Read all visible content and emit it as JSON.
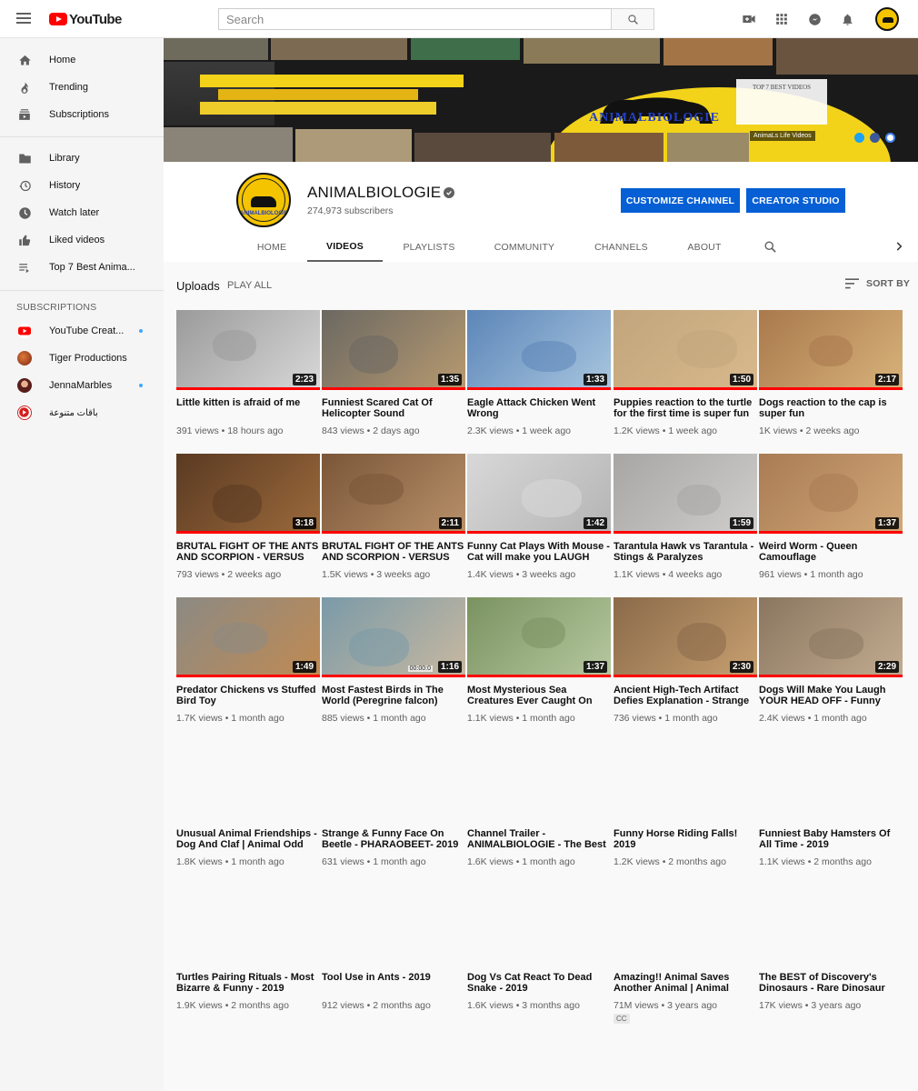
{
  "topbar": {
    "logo_text": "YouTube",
    "search_placeholder": "Search",
    "search_value": ""
  },
  "sidebar": {
    "main": [
      {
        "label": "Home",
        "icon": "home-icon"
      },
      {
        "label": "Trending",
        "icon": "flame-icon"
      },
      {
        "label": "Subscriptions",
        "icon": "subscriptions-icon"
      }
    ],
    "library": [
      {
        "label": "Library",
        "icon": "folder-icon"
      },
      {
        "label": "History",
        "icon": "history-icon"
      },
      {
        "label": "Watch later",
        "icon": "clock-icon"
      },
      {
        "label": "Liked videos",
        "icon": "thumbs-up-icon"
      },
      {
        "label": "Top 7 Best Anima...",
        "icon": "playlist-icon"
      }
    ],
    "subscriptions_heading": "SUBSCRIPTIONS",
    "subscriptions": [
      {
        "label": "YouTube Creat...",
        "color": "#ff0000",
        "new": true
      },
      {
        "label": "Tiger Productions",
        "color": "#b5421a",
        "new": false
      },
      {
        "label": "JennaMarbles",
        "color": "#7a2a2a",
        "new": true
      },
      {
        "label": "باقات متنوعة",
        "color": "#d32020",
        "new": false
      }
    ]
  },
  "banner": {
    "center_name": "ANIMALBIOLOGIE",
    "side_text": "TOP 7 BEST VIDEOS",
    "tag": "AnimaLs Life Videos"
  },
  "channel": {
    "avatar_label": "ANIMALBIOLOGIE",
    "name": "ANIMALBIOLOGIE",
    "subscribers": "274,973 subscribers",
    "customize_label": "CUSTOMIZE CHANNEL",
    "studio_label": "CREATOR STUDIO",
    "tabs": [
      "HOME",
      "VIDEOS",
      "PLAYLISTS",
      "COMMUNITY",
      "CHANNELS",
      "ABOUT"
    ],
    "active_tab": "VIDEOS"
  },
  "section": {
    "title": "Uploads",
    "play_all": "PLAY ALL",
    "sort_by": "SORT BY"
  },
  "videos": [
    {
      "title": "Little kitten is afraid of me",
      "views": "391 views",
      "age": "18 hours ago",
      "duration": "2:23",
      "colors": [
        "#9a9a9a",
        "#d8d8d8"
      ]
    },
    {
      "title": "Funniest Scared Cat Of Helicopter Sound",
      "views": "843 views",
      "age": "2 days ago",
      "duration": "1:35",
      "colors": [
        "#6b6862",
        "#b79a70"
      ]
    },
    {
      "title": "Eagle Attack Chicken Went Wrong",
      "views": "2.3K views",
      "age": "1 week ago",
      "duration": "1:33",
      "colors": [
        "#5c86b8",
        "#a9c6e0"
      ]
    },
    {
      "title": "Puppies reaction to the turtle for the first time is super fun",
      "views": "1.2K views",
      "age": "1 week ago",
      "duration": "1:50",
      "colors": [
        "#c2a57c",
        "#d8b98c"
      ]
    },
    {
      "title": "Dogs reaction to the cap is super fun",
      "views": "1K views",
      "age": "2 weeks ago",
      "duration": "2:17",
      "colors": [
        "#a9794c",
        "#d8b27a"
      ]
    },
    {
      "title": "BRUTAL FIGHT OF THE ANTS AND SCORPION - VERSUS OF",
      "views": "793 views",
      "age": "2 weeks ago",
      "duration": "3:18",
      "colors": [
        "#5a3a22",
        "#9c6a3c"
      ]
    },
    {
      "title": "BRUTAL FIGHT OF THE ANTS AND SCORPION - VERSUS OF",
      "views": "1.5K views",
      "age": "3 weeks ago",
      "duration": "2:11",
      "colors": [
        "#7a5638",
        "#b8906a"
      ]
    },
    {
      "title": "Funny Cat Plays With Mouse - Cat will make you LAUGH",
      "views": "1.4K views",
      "age": "3 weeks ago",
      "duration": "1:42",
      "colors": [
        "#d8d8d8",
        "#b4b4b4"
      ]
    },
    {
      "title": "Tarantula Hawk vs Tarantula - Stings & Paralyzes",
      "views": "1.1K views",
      "age": "4 weeks ago",
      "duration": "1:59",
      "colors": [
        "#a8a6a4",
        "#d0cecc"
      ]
    },
    {
      "title": "Weird Worm - Queen Camouflage",
      "views": "961 views",
      "age": "1 month ago",
      "duration": "1:37",
      "colors": [
        "#a97c54",
        "#d2a878"
      ]
    },
    {
      "title": "Predator Chickens vs Stuffed Bird Toy",
      "views": "1.7K views",
      "age": "1 month ago",
      "duration": "1:49",
      "colors": [
        "#8c8a84",
        "#c08a52"
      ]
    },
    {
      "title": "Most Fastest Birds in The World (Peregrine falcon)",
      "views": "885 views",
      "age": "1 month ago",
      "duration": "1:16",
      "colors": [
        "#7a9aa8",
        "#c8b8a0"
      ],
      "overlay": "00:00:0"
    },
    {
      "title": "Most Mysterious Sea Creatures Ever Caught On",
      "views": "1.1K views",
      "age": "1 month ago",
      "duration": "1:37",
      "colors": [
        "#7a9260",
        "#b6c8a0"
      ]
    },
    {
      "title": "Ancient High-Tech Artifact Defies Explanation - Strange",
      "views": "736 views",
      "age": "1 month ago",
      "duration": "2:30",
      "colors": [
        "#8a6a4a",
        "#c8a070"
      ]
    },
    {
      "title": "Dogs Will Make You Laugh YOUR HEAD OFF - Funny",
      "views": "2.4K views",
      "age": "1 month ago",
      "duration": "2:29",
      "colors": [
        "#8a7660",
        "#c2ac90"
      ]
    },
    {
      "title": "Unusual Animal Friendships - Dog And Claf | Animal Odd",
      "views": "1.8K views",
      "age": "1 month ago",
      "duration": "",
      "colors": []
    },
    {
      "title": "Strange & Funny Face On Beetle - PHARAOBEET- 2019",
      "views": "631 views",
      "age": "1 month ago",
      "duration": "",
      "colors": []
    },
    {
      "title": "Channel Trailer - ANIMALBIOLOGIE - The Best",
      "views": "1.6K views",
      "age": "1 month ago",
      "duration": "",
      "colors": []
    },
    {
      "title": "Funny Horse Riding Falls! 2019",
      "views": "1.2K views",
      "age": "2 months ago",
      "duration": "",
      "colors": []
    },
    {
      "title": "Funniest Baby Hamsters Of All Time - 2019",
      "views": "1.1K views",
      "age": "2 months ago",
      "duration": "",
      "colors": []
    },
    {
      "title": "Turtles Pairing Rituals - Most Bizarre & Funny - 2019",
      "views": "1.9K views",
      "age": "2 months ago",
      "duration": "",
      "colors": []
    },
    {
      "title": "Tool Use in Ants - 2019",
      "views": "912 views",
      "age": "2 months ago",
      "duration": "",
      "colors": []
    },
    {
      "title": "Dog Vs Cat React To Dead Snake - 2019",
      "views": "1.6K views",
      "age": "3 months ago",
      "duration": "",
      "colors": []
    },
    {
      "title": "Amazing!! Animal Saves Another Animal | Animal",
      "views": "71M views",
      "age": "3 years ago",
      "duration": "",
      "colors": [],
      "badge": "CC"
    },
    {
      "title": "The BEST of Discovery's Dinosaurs - Rare Dinosaur",
      "views": "17K views",
      "age": "3 years ago",
      "duration": "",
      "colors": []
    }
  ]
}
